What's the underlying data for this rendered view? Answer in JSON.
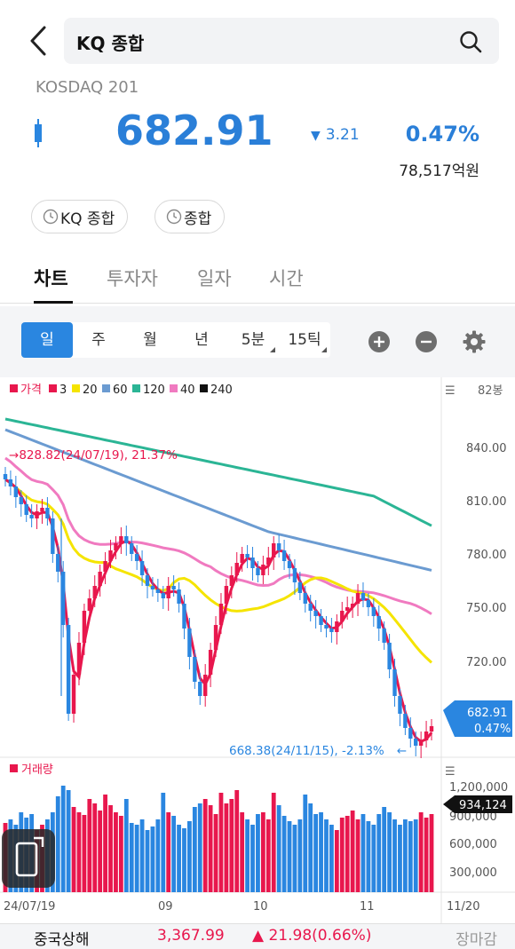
{
  "header": {
    "search_text": "KQ 종합"
  },
  "quote": {
    "subtitle": "KOSDAQ 201",
    "price": "682.91",
    "change": "3.21",
    "change_pct": "0.47%",
    "trade_value": "78,517억원"
  },
  "chips": [
    "KQ 종합",
    "종합"
  ],
  "tabs": [
    "차트",
    "투자자",
    "일자",
    "시간"
  ],
  "period_buttons": [
    "일",
    "주",
    "월",
    "년",
    "5분",
    "15틱"
  ],
  "legend": {
    "items": [
      {
        "label": "가격",
        "color": "#e8174d"
      },
      {
        "label": "3",
        "color": "#e8174d"
      },
      {
        "label": "20",
        "color": "#f5e400"
      },
      {
        "label": "60",
        "color": "#6b9bd1"
      },
      {
        "label": "120",
        "color": "#2bb595"
      },
      {
        "label": "40",
        "color": "#f07ac0"
      },
      {
        "label": "240",
        "color": "#111111"
      }
    ],
    "count": "82봉",
    "volume_label": "거래량"
  },
  "annotations": {
    "high": "828.82(24/07/19), 21.37%",
    "low": "668.38(24/11/15), -2.13%",
    "current_price": "682.91",
    "current_pct": "0.47%",
    "current_volume": "934,124"
  },
  "chart_data": {
    "type": "candlestick",
    "y_ticks": [
      "840.00",
      "810.00",
      "780.00",
      "750.00",
      "720.00"
    ],
    "volume_ticks": [
      "1,200,000",
      "900,000",
      "600,000",
      "300,000"
    ],
    "x_ticks": [
      "24/07/19",
      "09",
      "10",
      "11",
      "11/20"
    ],
    "ylim": [
      660,
      850
    ]
  },
  "footer": {
    "index_name": "중국상해",
    "index_value": "3,367.99",
    "index_change": "▲ 21.98(0.66%)",
    "status": "장마감"
  },
  "colors": {
    "up": "#e8174d",
    "down": "#2a86e0",
    "accent": "#2a7fd8"
  }
}
